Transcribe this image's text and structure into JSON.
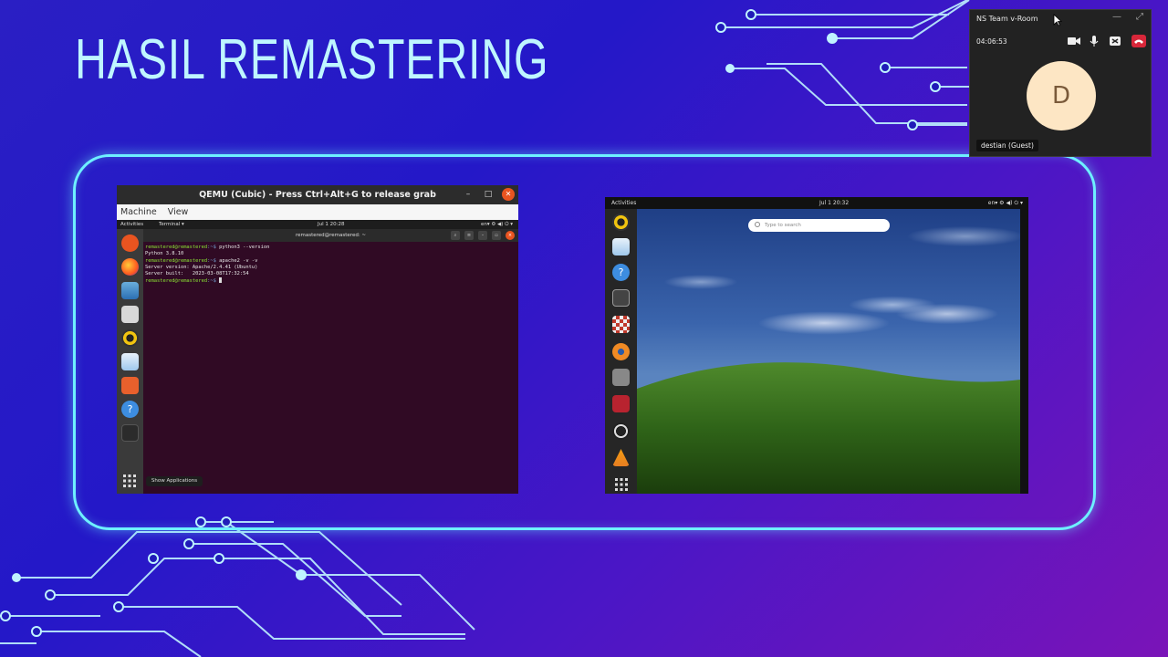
{
  "slide": {
    "title": "HASIL REMASTERING"
  },
  "qemu": {
    "title": "QEMU (Cubic) - Press Ctrl+Alt+G to release grab",
    "menus": [
      "Machine",
      "View"
    ],
    "guest_topbar": {
      "activities": "Activities",
      "app": "Terminal ▾",
      "clock": "Jul 1  20:28",
      "tray": "en▾   ⚙ ◀) ⏻ ▾"
    },
    "terminal": {
      "title": "remastered@remastered: ~",
      "lines": [
        {
          "prompt": "remastered@remastered",
          "path": ":~$ ",
          "cmd": "python3 --version"
        },
        {
          "out": "Python 3.8.10"
        },
        {
          "prompt": "remastered@remastered",
          "path": ":~$ ",
          "cmd": "apache2 -v -v"
        },
        {
          "out": "Server version: Apache/2.4.41 (Ubuntu)"
        },
        {
          "out": "Server built:   2023-03-08T17:32:54"
        },
        {
          "prompt": "remastered@remastered",
          "path": ":~$ ",
          "cmd": ""
        }
      ]
    },
    "show_applications": "Show Applications",
    "dock_icons": [
      "ubuntu-icon",
      "firefox-icon",
      "thunderbird-icon",
      "files-icon",
      "rhythmbox-icon",
      "writer-icon",
      "software-center-icon",
      "help-icon",
      "terminal-icon"
    ]
  },
  "desktop": {
    "topbar": {
      "activities": "Activities",
      "clock": "Jul 1  20:32",
      "tray": "en▾   ⚙ ◀) ⏻ ▾"
    },
    "search_placeholder": "Type to search",
    "dock_icons": [
      "rhythmbox-icon",
      "writer-icon",
      "help-icon",
      "inkscape-icon",
      "chess-icon",
      "blender-icon",
      "camera-icon",
      "mendeley-icon",
      "obs-icon",
      "vlc-icon",
      "apps-grid-icon"
    ]
  },
  "call": {
    "title": "NS Team v-Room",
    "timer": "04:06:53",
    "avatar_initial": "D",
    "guest_name": "destian (Guest)"
  }
}
